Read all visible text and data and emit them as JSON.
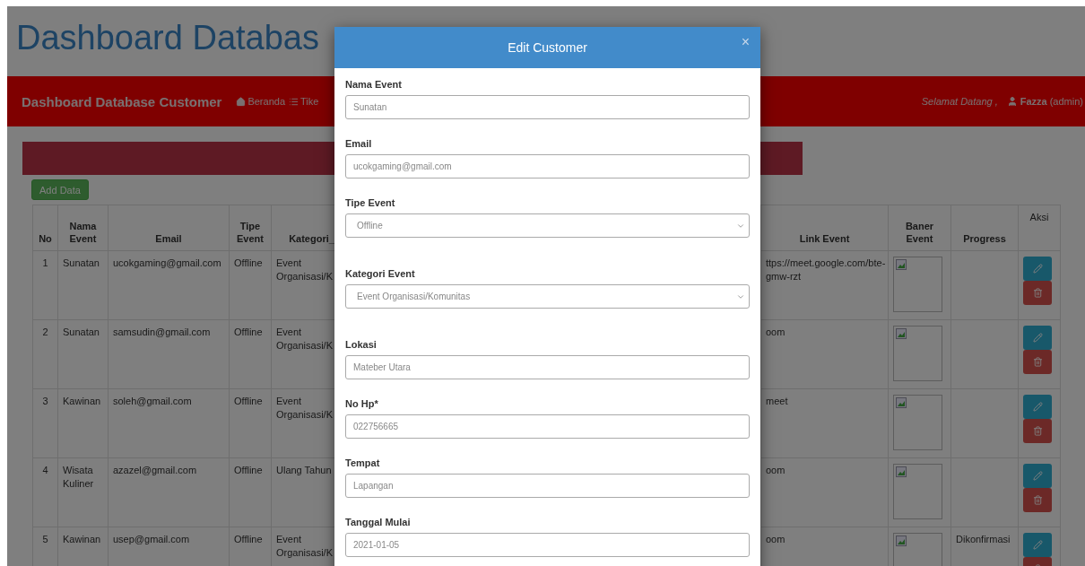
{
  "page": {
    "title": "Dashboard Databas"
  },
  "navbar": {
    "brand": "Dashboard Database Customer",
    "links": [
      {
        "label": "Beranda"
      },
      {
        "label": "Tike"
      }
    ],
    "greeting": "Selamat Datang ,",
    "user": "Fazza",
    "role": "(admin)"
  },
  "add_button": "Add Data",
  "table": {
    "left_columns": [
      {
        "label": "No",
        "kind": "data"
      },
      {
        "label": "Nama Event",
        "kind": "data"
      },
      {
        "label": "Email",
        "kind": "data"
      },
      {
        "label": "Tipe Event",
        "kind": "data"
      },
      {
        "label": "Kategori_",
        "kind": "data"
      }
    ],
    "right_columns": [
      {
        "label": "Link Event",
        "kind": "data"
      },
      {
        "label": "Baner Event",
        "kind": "data"
      },
      {
        "label": "Progress",
        "kind": "data"
      },
      {
        "label": "Aksi",
        "kind": "action"
      }
    ],
    "rows": [
      {
        "no": "1",
        "nama_event": "Sunatan",
        "email": "ucokgaming@gmail.com",
        "tipe_event": "Offline",
        "kategori": "Event Organisasi/K",
        "link": "ttps://meet.google.com/bte-gmw-rzt"
      },
      {
        "no": "2",
        "nama_event": "Sunatan",
        "email": "samsudin@gmail.com",
        "tipe_event": "Offline",
        "kategori": "Event Organisasi/K",
        "link": "oom"
      },
      {
        "no": "3",
        "nama_event": "Kawinan",
        "email": "soleh@gmail.com",
        "tipe_event": "Offline",
        "kategori": "Event Organisasi/K",
        "link": "meet"
      },
      {
        "no": "4",
        "nama_event": "Wisata Kuliner",
        "email": "azazel@gmail.com",
        "tipe_event": "Offline",
        "kategori": "Ulang Tahun",
        "link": "oom"
      },
      {
        "no": "5",
        "nama_event": "Kawinan",
        "email": "usep@gmail.com",
        "tipe_event": "Offline",
        "kategori": "Event Organisasi/K",
        "link": "oom",
        "progress": "Dikonfirmasi"
      }
    ]
  },
  "modal": {
    "title": "Edit Customer",
    "close": "×",
    "fields": [
      {
        "label": "Nama Event",
        "kind": "text",
        "value": "Sunatan"
      },
      {
        "label": "Email",
        "kind": "text",
        "value": "ucokgaming@gmail.com"
      },
      {
        "label": "Tipe Event",
        "kind": "select",
        "value": "Offline"
      },
      {
        "label": "Kategori Event",
        "kind": "select",
        "value": "Event Organisasi/Komunitas"
      },
      {
        "label": "Lokasi",
        "kind": "text",
        "value": "Mateber Utara"
      },
      {
        "label": "No Hp*",
        "kind": "text",
        "value": "022756665"
      },
      {
        "label": "Tempat",
        "kind": "text",
        "value": "Lapangan"
      },
      {
        "label": "Tanggal Mulai",
        "kind": "text",
        "value": "2021-01-05"
      }
    ]
  }
}
